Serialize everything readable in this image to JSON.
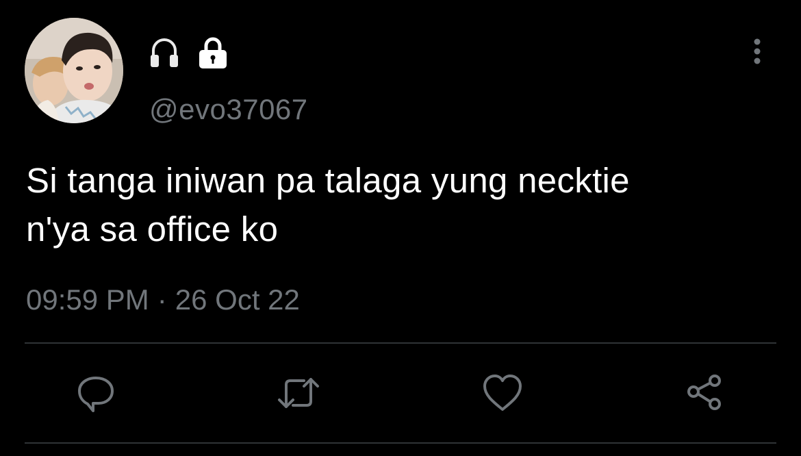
{
  "header": {
    "handle": "@evo37067",
    "icons": [
      "headphones-icon",
      "lock-icon"
    ]
  },
  "tweet": {
    "text_line1": "Si tanga iniwan pa talaga yung necktie",
    "text_line2": "n'ya sa office ko",
    "time": "09:59 PM",
    "separator": "·",
    "date": "26 Oct 22"
  },
  "actions": [
    "reply-icon",
    "retweet-icon",
    "like-icon",
    "share-icon"
  ],
  "colors": {
    "background": "#000000",
    "text": "#ffffff",
    "secondary": "#71767b",
    "divider": "#2f3336"
  }
}
